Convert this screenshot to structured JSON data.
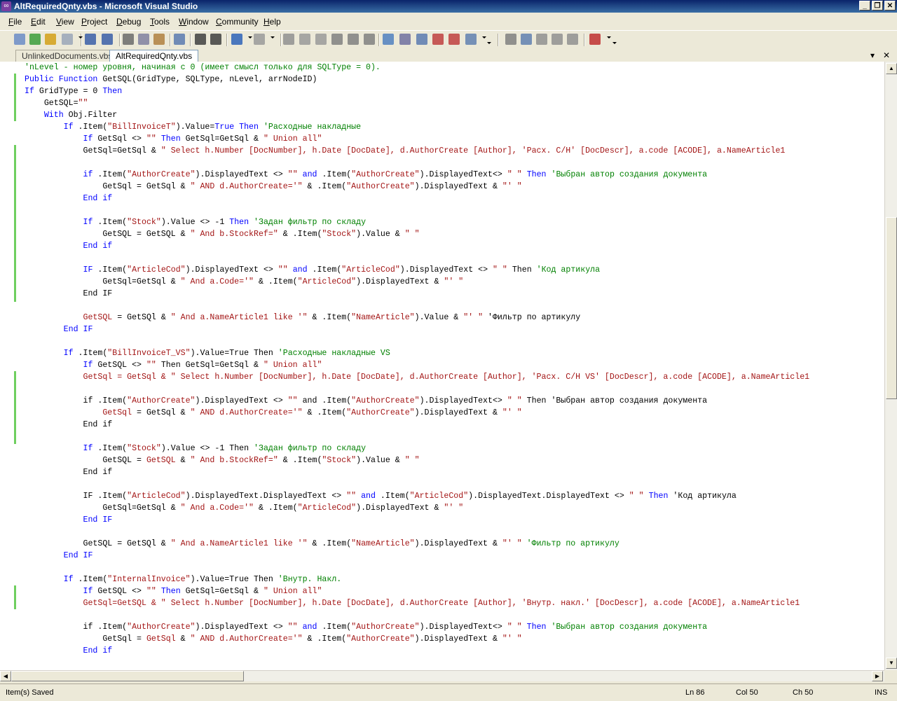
{
  "window": {
    "title": "AltRequiredQnty.vbs - Microsoft Visual Studio",
    "minimize": "_",
    "restore": "❐",
    "close": "✕"
  },
  "menu": [
    {
      "pre": "",
      "u": "F",
      "post": "ile"
    },
    {
      "pre": "",
      "u": "E",
      "post": "dit"
    },
    {
      "pre": "",
      "u": "V",
      "post": "iew"
    },
    {
      "pre": "",
      "u": "P",
      "post": "roject"
    },
    {
      "pre": "",
      "u": "D",
      "post": "ebug"
    },
    {
      "pre": "",
      "u": "T",
      "post": "ools"
    },
    {
      "pre": "",
      "u": "W",
      "post": "indow"
    },
    {
      "pre": "",
      "u": "C",
      "post": "ommunity"
    },
    {
      "pre": "",
      "u": "H",
      "post": "elp"
    }
  ],
  "tabs": {
    "inactive": "UnlinkedDocuments.vbs",
    "active": "AltRequiredQnty.vbs",
    "dropdown_icon": "▾",
    "close_icon": "✕"
  },
  "toolbar_icons": [
    "add-item-icon",
    "web-site-icon",
    "open-icon",
    "add-new-icon",
    "save-icon",
    "save-all-icon",
    "cut-icon",
    "copy-icon",
    "paste-icon",
    "find-in-files-icon",
    "comment-icon",
    "uncomment-icon",
    "undo-icon",
    "redo-icon",
    "start-debug-icon",
    "break-all-icon",
    "stop-debug-icon",
    "step-into-icon",
    "step-over-icon",
    "step-out-icon",
    "solution-explorer-icon",
    "properties-icon",
    "object-browser-icon",
    "toolbox-icon",
    "error-list-icon",
    "command-window-icon",
    "indent-icon",
    "bookmark-icon",
    "prev-bookmark-icon",
    "next-bookmark-icon",
    "clear-bookmark-icon",
    "breakpoint-icon"
  ],
  "code_lines": [
    [
      [
        "cm",
        "'nLevel - номер уровня, начиная с 0 (имеет смысл только для SQLType = 0)."
      ]
    ],
    [
      [
        "kw",
        "Public Function "
      ],
      [
        "",
        "GetSQL(GridType, SQLType, nLevel, arrNodeID)"
      ]
    ],
    [
      [
        "kw",
        "If "
      ],
      [
        "",
        "GridType = 0 "
      ],
      [
        "kw",
        "Then"
      ]
    ],
    [
      [
        "",
        "    GetSQL="
      ],
      [
        "st",
        "\"\""
      ]
    ],
    [
      [
        "kw",
        "    With "
      ],
      [
        "",
        "Obj.Filter"
      ]
    ],
    [
      [
        "kw",
        "        If "
      ],
      [
        "",
        ".Item("
      ],
      [
        "st",
        "\"BillInvoiceT\""
      ],
      [
        "",
        ").Value="
      ],
      [
        "kw",
        "True Then "
      ],
      [
        "cm",
        "'Расходные накладные"
      ]
    ],
    [
      [
        "kw",
        "            If "
      ],
      [
        "",
        "GetSql <> "
      ],
      [
        "st",
        "\"\" "
      ],
      [
        "kw",
        "Then "
      ],
      [
        "",
        "GetSql=GetSql & "
      ],
      [
        "st",
        "\" Union all\""
      ]
    ],
    [
      [
        "",
        "            GetSql=GetSql & "
      ],
      [
        "st",
        "\" Select h.Number [DocNumber], h.Date [DocDate], d.AuthorCreate [Author], 'Расх. С/Н' [DocDescr], a.code [ACODE], a.NameArticle1"
      ]
    ],
    [
      [
        "",
        ""
      ]
    ],
    [
      [
        "kw",
        "            if "
      ],
      [
        "",
        ".Item("
      ],
      [
        "st",
        "\"AuthorCreate\""
      ],
      [
        "",
        ").DisplayedText <> "
      ],
      [
        "st",
        "\"\" "
      ],
      [
        "kw",
        "and "
      ],
      [
        "",
        ".Item("
      ],
      [
        "st",
        "\"AuthorCreate\""
      ],
      [
        "",
        ").DisplayedText<> "
      ],
      [
        "st",
        "\" \" "
      ],
      [
        "kw",
        "Then "
      ],
      [
        "cm",
        "'Выбран автор создания документа"
      ]
    ],
    [
      [
        "",
        "                GetSql = GetSql & "
      ],
      [
        "st",
        "\" AND d.AuthorCreate='\""
      ],
      [
        "",
        " & .Item("
      ],
      [
        "st",
        "\"AuthorCreate\""
      ],
      [
        "",
        ").DisplayedText & "
      ],
      [
        "st",
        "\"' \""
      ]
    ],
    [
      [
        "kw",
        "            End if"
      ]
    ],
    [
      [
        "",
        ""
      ]
    ],
    [
      [
        "kw",
        "            If "
      ],
      [
        "",
        ".Item("
      ],
      [
        "st",
        "\"Stock\""
      ],
      [
        "",
        ").Value <> -1 "
      ],
      [
        "kw",
        "Then "
      ],
      [
        "cm",
        "'Задан фильтр по складу"
      ]
    ],
    [
      [
        "",
        "                GetSQL = GetSQL & "
      ],
      [
        "st",
        "\" And b.StockRef=\""
      ],
      [
        "",
        " & .Item("
      ],
      [
        "st",
        "\"Stock\""
      ],
      [
        "",
        ").Value & "
      ],
      [
        "st",
        "\" \""
      ]
    ],
    [
      [
        "kw",
        "            End if"
      ]
    ],
    [
      [
        "",
        ""
      ]
    ],
    [
      [
        "kw",
        "            IF "
      ],
      [
        "",
        ".Item("
      ],
      [
        "st",
        "\"ArticleCod\""
      ],
      [
        "",
        ").DisplayedText <> "
      ],
      [
        "st",
        "\"\" "
      ],
      [
        "kw",
        "and "
      ],
      [
        "",
        ".Item("
      ],
      [
        "st",
        "\"ArticleCod\""
      ],
      [
        "",
        ").DisplayedText <> "
      ],
      [
        "st",
        "\" \" "
      ],
      [
        "",
        "Then "
      ],
      [
        "cm",
        "'Код артикула"
      ]
    ],
    [
      [
        "",
        "                GetSql=GetSql & "
      ],
      [
        "st",
        "\" And a.Code='\""
      ],
      [
        "",
        " & .Item("
      ],
      [
        "st",
        "\"ArticleCod\""
      ],
      [
        "",
        ").DisplayedText & "
      ],
      [
        "st",
        "\"' \""
      ]
    ],
    [
      [
        "",
        "            End IF"
      ]
    ],
    [
      [
        "",
        ""
      ]
    ],
    [
      [
        "st",
        "            GetSQL "
      ],
      [
        "",
        "= GetSQl & "
      ],
      [
        "st",
        "\" And a.NameArticle1 like '\""
      ],
      [
        "",
        " & .Item("
      ],
      [
        "st",
        "\"NameArticle\""
      ],
      [
        "",
        ").Value & "
      ],
      [
        "st",
        "\"' \" "
      ],
      [
        "",
        "'Фильтр по артикулу"
      ]
    ],
    [
      [
        "kw",
        "        End IF"
      ]
    ],
    [
      [
        "",
        ""
      ]
    ],
    [
      [
        "kw",
        "        If "
      ],
      [
        "",
        ".Item("
      ],
      [
        "st",
        "\"BillInvoiceT_VS\""
      ],
      [
        "",
        ").Value=True Then "
      ],
      [
        "cm",
        "'Расходные накладные VS"
      ]
    ],
    [
      [
        "kw",
        "            If "
      ],
      [
        "",
        "GetSQL <> "
      ],
      [
        "st",
        "\"\" "
      ],
      [
        "",
        "Then GetSql=GetSql & "
      ],
      [
        "st",
        "\" Union all\""
      ]
    ],
    [
      [
        "st",
        "            GetSql = GetSql & \" Select h.Number [DocNumber], h.Date [DocDate], d.AuthorCreate [Author], 'Расх. С/Н VS' [DocDescr], a.code [ACODE], a.NameArticle1"
      ]
    ],
    [
      [
        "",
        ""
      ]
    ],
    [
      [
        "",
        "            if .Item("
      ],
      [
        "st",
        "\"AuthorCreate\""
      ],
      [
        "",
        ").DisplayedText <> "
      ],
      [
        "st",
        "\"\" "
      ],
      [
        "",
        "and .Item("
      ],
      [
        "st",
        "\"AuthorCreate\""
      ],
      [
        "",
        ").DisplayedText<> "
      ],
      [
        "st",
        "\" \" "
      ],
      [
        "",
        "Then 'Выбран автор создания документа"
      ]
    ],
    [
      [
        "st",
        "                GetSql "
      ],
      [
        "",
        "= GetSql & "
      ],
      [
        "st",
        "\" AND d.AuthorCreate='\""
      ],
      [
        "",
        " & .Item("
      ],
      [
        "st",
        "\"AuthorCreate\""
      ],
      [
        "",
        ").DisplayedText & "
      ],
      [
        "st",
        "\"' \""
      ]
    ],
    [
      [
        "",
        "            End if"
      ]
    ],
    [
      [
        "",
        ""
      ]
    ],
    [
      [
        "kw",
        "            If "
      ],
      [
        "",
        ".Item("
      ],
      [
        "st",
        "\"Stock\""
      ],
      [
        "",
        ").Value <> -1 Then "
      ],
      [
        "cm",
        "'Задан фильтр по складу"
      ]
    ],
    [
      [
        "",
        "                GetSQL = "
      ],
      [
        "st",
        "GetSQL "
      ],
      [
        "",
        "& "
      ],
      [
        "st",
        "\" And b.StockRef=\""
      ],
      [
        "",
        " & .Item("
      ],
      [
        "st",
        "\"Stock\""
      ],
      [
        "",
        ").Value & "
      ],
      [
        "st",
        "\" \""
      ]
    ],
    [
      [
        "",
        "            End if"
      ]
    ],
    [
      [
        "",
        ""
      ]
    ],
    [
      [
        "",
        "            IF .Item("
      ],
      [
        "st",
        "\"ArticleCod\""
      ],
      [
        "",
        ").DisplayedText.DisplayedText <> "
      ],
      [
        "st",
        "\"\" "
      ],
      [
        "kw",
        "and "
      ],
      [
        "",
        ".Item("
      ],
      [
        "st",
        "\"ArticleCod\""
      ],
      [
        "",
        ").DisplayedText.DisplayedText <> "
      ],
      [
        "st",
        "\" \" "
      ],
      [
        "kw",
        "Then "
      ],
      [
        "",
        "'Код артикула"
      ]
    ],
    [
      [
        "",
        "                GetSql=GetSql & "
      ],
      [
        "st",
        "\" And a.Code='\""
      ],
      [
        "",
        " & .Item("
      ],
      [
        "st",
        "\"ArticleCod\""
      ],
      [
        "",
        ").DisplayedText & "
      ],
      [
        "st",
        "\"' \""
      ]
    ],
    [
      [
        "kw",
        "            End IF"
      ]
    ],
    [
      [
        "",
        ""
      ]
    ],
    [
      [
        "",
        "            GetSQL = GetSQl & "
      ],
      [
        "st",
        "\" And a.NameArticle1 like '\""
      ],
      [
        "",
        " & .Item("
      ],
      [
        "st",
        "\"NameArticle\""
      ],
      [
        "",
        ").DisplayedText & "
      ],
      [
        "st",
        "\"' \" "
      ],
      [
        "cm",
        "'Фильтр по артикулу"
      ]
    ],
    [
      [
        "kw",
        "        End IF"
      ]
    ],
    [
      [
        "",
        ""
      ]
    ],
    [
      [
        "kw",
        "        If "
      ],
      [
        "",
        ".Item("
      ],
      [
        "st",
        "\"InternalInvoice\""
      ],
      [
        "",
        ").Value=True Then "
      ],
      [
        "cm",
        "'Внутр. Накл."
      ]
    ],
    [
      [
        "kw",
        "            If "
      ],
      [
        "",
        "GetSQL <> "
      ],
      [
        "st",
        "\"\" "
      ],
      [
        "kw",
        "Then "
      ],
      [
        "",
        "GetSql=GetSql & "
      ],
      [
        "st",
        "\" Union all\""
      ]
    ],
    [
      [
        "st",
        "            GetSql=GetSQL & \" Select h.Number [DocNumber], h.Date [DocDate], d.AuthorCreate [Author], 'Внутр. накл.' [DocDescr], a.code [ACODE], a.NameArticle1"
      ]
    ],
    [
      [
        "",
        ""
      ]
    ],
    [
      [
        "",
        "            if .Item("
      ],
      [
        "st",
        "\"AuthorCreate\""
      ],
      [
        "",
        ").DisplayedText <> "
      ],
      [
        "st",
        "\"\" "
      ],
      [
        "kw",
        "and "
      ],
      [
        "",
        ".Item("
      ],
      [
        "st",
        "\"AuthorCreate\""
      ],
      [
        "",
        ").DisplayedText<> "
      ],
      [
        "st",
        "\" \" "
      ],
      [
        "kw",
        "Then "
      ],
      [
        "cm",
        "'Выбран автор создания документа"
      ]
    ],
    [
      [
        "",
        "                GetSql = "
      ],
      [
        "st",
        "GetSql "
      ],
      [
        "",
        "& "
      ],
      [
        "st",
        "\" AND d.AuthorCreate='\""
      ],
      [
        "",
        " & .Item("
      ],
      [
        "st",
        "\"AuthorCreate\""
      ],
      [
        "",
        ").DisplayedText & "
      ],
      [
        "st",
        "\"' \""
      ]
    ],
    [
      [
        "kw",
        "            End if"
      ]
    ]
  ],
  "status": {
    "message": "Item(s) Saved",
    "line": "Ln 86",
    "col": "Col 50",
    "ch": "Ch 50",
    "mode": "INS"
  }
}
